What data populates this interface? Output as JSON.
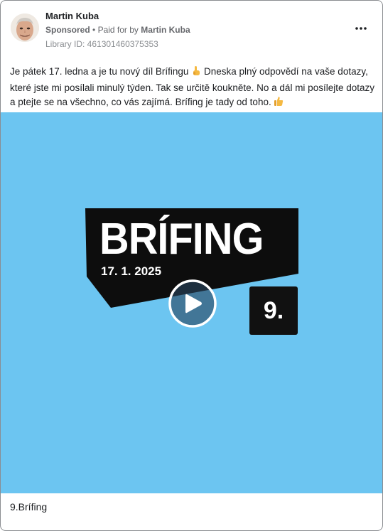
{
  "post": {
    "author": "Martin Kuba",
    "sponsored_label": "Sponsored",
    "paid_for_prefix": "Paid for by",
    "paid_for_by": "Martin Kuba",
    "library_id": "Library ID: 461301460375353",
    "more_icon": "three-dots-icon",
    "text_part1": "Je pátek 17. ledna a je tu nový díl Brífingu",
    "text_part2": " Dneska plný odpovědí na vaše dotazy, které jste mi posílali minulý týden. Tak se určitě koukněte. No a dál mi posílejte dotazy a ptejte se na všechno, co vás zajímá. Brífing je tady od toho.",
    "emoji_1": "pointing-up-hand-emoji",
    "emoji_2": "thumbs-up-emoji"
  },
  "media": {
    "background_color": "#6cc5f1",
    "logo_title": "BRÍFING",
    "logo_date": "17. 1. 2025",
    "episode_number": "9.",
    "play_icon": "play-icon"
  },
  "caption": "9.Brífing"
}
